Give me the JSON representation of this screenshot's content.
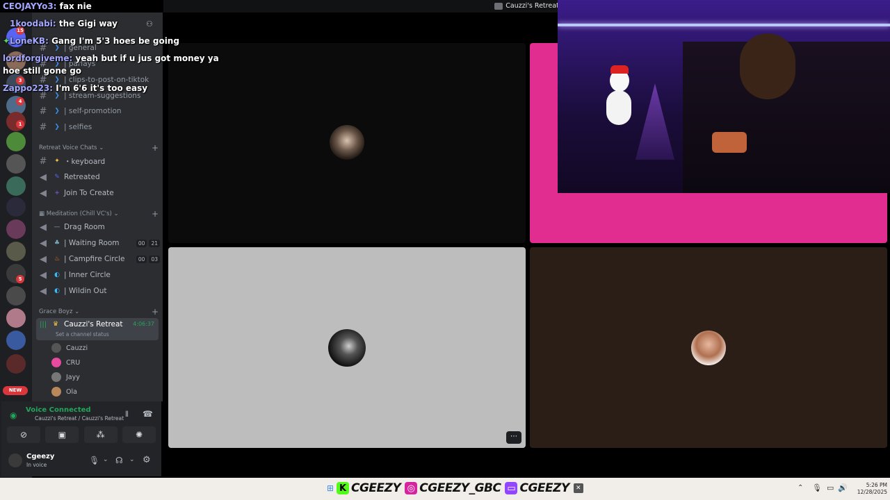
{
  "window": {
    "title": "Cauzzi's Retreat"
  },
  "rail": {
    "badges": [
      "15",
      "3",
      "4",
      "1",
      "5"
    ],
    "new_label": "NEW"
  },
  "sidebar": {
    "channels_top": [
      {
        "label": "| general"
      },
      {
        "label": "| parlays"
      },
      {
        "label": "| clips-to-post-on-tiktok"
      },
      {
        "label": "| stream-suggestions"
      },
      {
        "label": "| self-promotion"
      },
      {
        "label": "| selfies"
      }
    ],
    "cat_voice": "Retreat Voice Chats",
    "voice_channels": [
      {
        "label": "・keyboard",
        "type": "text"
      },
      {
        "label": "Retreated",
        "type": "voice"
      },
      {
        "label": "Join To Create",
        "type": "voice"
      }
    ],
    "cat_meditation": "Meditation (Chill VC's)",
    "meditation": [
      {
        "label": "Drag Room"
      },
      {
        "label": "| Waiting Room",
        "c1": "00",
        "c2": "21"
      },
      {
        "label": "| Campfire Circle",
        "c1": "00",
        "c2": "03"
      },
      {
        "label": "| Inner Circle"
      },
      {
        "label": "| Wildin Out"
      }
    ],
    "cat_grace": "Grace Boyz",
    "active_channel": {
      "label": "Cauzzi's Retreat",
      "timer": "4:06:37",
      "status": "Set a channel status"
    },
    "members": [
      "Cauzzi",
      "CRU",
      "Jayy",
      "Ola"
    ]
  },
  "voice_panel": {
    "status": "Voice Connected",
    "location": "Cauzzi's Retreat / Cauzzi's Retreat"
  },
  "user": {
    "name": "Cgeezy",
    "status": "In voice"
  },
  "chat": [
    {
      "user": "CEOJAYYo3:",
      "msg": "fax nie"
    },
    {
      "user": "1koodabi:",
      "msg": "the Gigi way"
    },
    {
      "user": "LoneKB:",
      "msg": "Gang I'm 5'3 hoes be going"
    },
    {
      "user": "lordforgiveme:",
      "msg": "yeah but if u jus got money ya"
    },
    {
      "user": "",
      "msg": "hoe still gone go"
    },
    {
      "user": "Zappo223:",
      "msg": "I'm 6'6 it's too easy"
    }
  ],
  "socials": {
    "kick": "CGEEZY",
    "instagram": "CGEEZY_GBC",
    "twitch": "CGEEZY"
  },
  "clock": {
    "time": "5:26 PM",
    "date": "12/28/2025"
  },
  "colors": {
    "pink_tile": "#e02d8f",
    "grey_tile": "#bdbdbd",
    "brown_tile": "#2b1e16",
    "dark_tile": "#0b0b0b",
    "voice_green": "#23a559"
  }
}
